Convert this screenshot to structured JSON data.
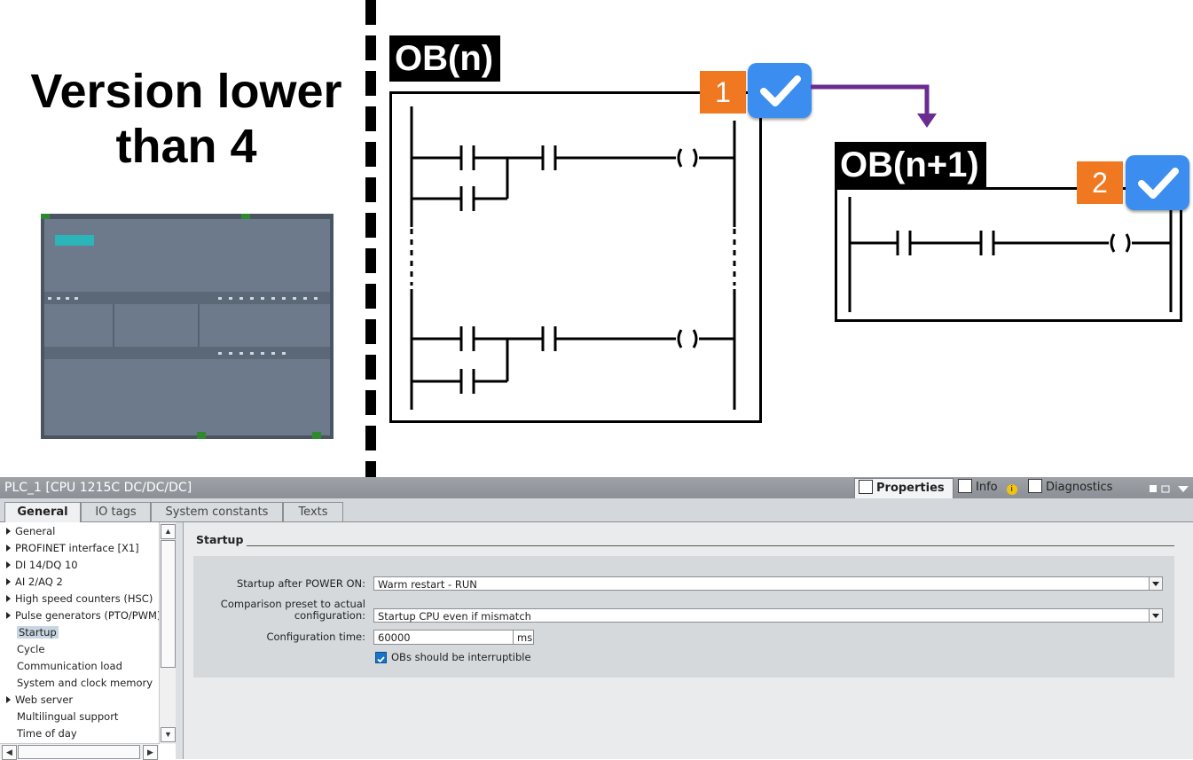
{
  "diagram": {
    "version_title": "Version lower\nthan 4",
    "ob_n_label": "OB(n)",
    "ob_n1_label": "OB(n+1)",
    "badge1": "1",
    "badge2": "2",
    "accent_orange": "#f07820",
    "accent_blue": "#3b8df0",
    "arrow_color": "#6a2c91"
  },
  "panel": {
    "title": "PLC_1 [CPU 1215C DC/DC/DC]",
    "right_tabs": [
      {
        "label": "Properties",
        "icon": "properties-icon"
      },
      {
        "label": "Info",
        "icon": "info-icon"
      },
      {
        "label": "Diagnostics",
        "icon": "diagnostics-icon"
      }
    ],
    "tabs": [
      "General",
      "IO tags",
      "System constants",
      "Texts"
    ],
    "nav_items": [
      {
        "label": "General",
        "expandable": true
      },
      {
        "label": "PROFINET interface [X1]",
        "expandable": true
      },
      {
        "label": "DI 14/DQ 10",
        "expandable": true
      },
      {
        "label": "AI 2/AQ 2",
        "expandable": true
      },
      {
        "label": "High speed counters (HSC)",
        "expandable": true
      },
      {
        "label": "Pulse generators (PTO/PWM)",
        "expandable": true
      },
      {
        "label": "Startup",
        "expandable": false,
        "selected": true
      },
      {
        "label": "Cycle",
        "expandable": false
      },
      {
        "label": "Communication load",
        "expandable": false
      },
      {
        "label": "System and clock memory",
        "expandable": false
      },
      {
        "label": "Web server",
        "expandable": true
      },
      {
        "label": "Multilingual support",
        "expandable": false
      },
      {
        "label": "Time of day",
        "expandable": false
      }
    ],
    "section_title": "Startup",
    "form": {
      "startup_label": "Startup after POWER ON:",
      "startup_value": "Warm restart - RUN",
      "comparison_label_1": "Comparison preset to actual",
      "comparison_label_2": "configuration:",
      "comparison_value": "Startup CPU even if mismatch",
      "config_time_label": "Configuration time:",
      "config_time_value": "60000",
      "config_time_unit": "ms",
      "obs_interruptible_label": "OBs should be interruptible",
      "obs_interruptible_checked": true
    }
  }
}
